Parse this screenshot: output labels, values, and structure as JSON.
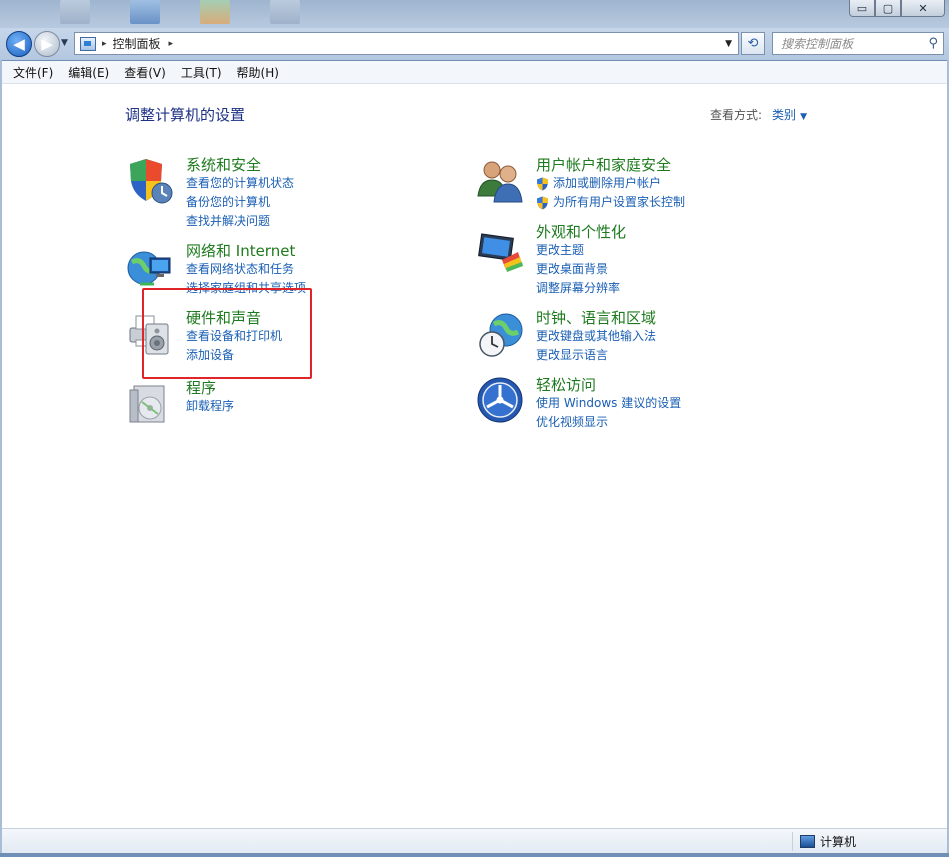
{
  "window": {
    "minimize": "▭",
    "maximize": "▢",
    "close": "✕"
  },
  "nav": {
    "back_glyph": "◀",
    "forward_glyph": "▶",
    "history_glyph": "▼",
    "address": {
      "crumb": "控制面板",
      "sep": "▸"
    },
    "dropdown_glyph": "▼",
    "refresh_glyph": "⟲",
    "search_placeholder": "搜索控制面板",
    "search_glyph": "⚲"
  },
  "menu": [
    "文件(F)",
    "编辑(E)",
    "查看(V)",
    "工具(T)",
    "帮助(H)"
  ],
  "page": {
    "title": "调整计算机的设置",
    "view_by_label": "查看方式:",
    "view_by_value": "类别",
    "view_by_caret": "▼"
  },
  "categories": {
    "system": {
      "title": "系统和安全",
      "links": [
        "查看您的计算机状态",
        "备份您的计算机",
        "查找并解决问题"
      ]
    },
    "network": {
      "title": "网络和 Internet",
      "links": [
        "查看网络状态和任务",
        "选择家庭组和共享选项"
      ]
    },
    "hardware": {
      "title": "硬件和声音",
      "links": [
        "查看设备和打印机",
        "添加设备"
      ]
    },
    "programs": {
      "title": "程序",
      "links": [
        "卸载程序"
      ]
    },
    "users": {
      "title": "用户帐户和家庭安全",
      "links": [
        "添加或删除用户帐户",
        "为所有用户设置家长控制"
      ]
    },
    "appearance": {
      "title": "外观和个性化",
      "links": [
        "更改主题",
        "更改桌面背景",
        "调整屏幕分辨率"
      ]
    },
    "clock": {
      "title": "时钟、语言和区域",
      "links": [
        "更改键盘或其他输入法",
        "更改显示语言"
      ]
    },
    "ease": {
      "title": "轻松访问",
      "links": [
        "使用 Windows 建议的设置",
        "优化视频显示"
      ]
    }
  },
  "status": {
    "computer": "计算机"
  },
  "colors": {
    "category_title": "#1e7a1e",
    "link": "#1a5fb4",
    "highlight": "#e0242a"
  }
}
